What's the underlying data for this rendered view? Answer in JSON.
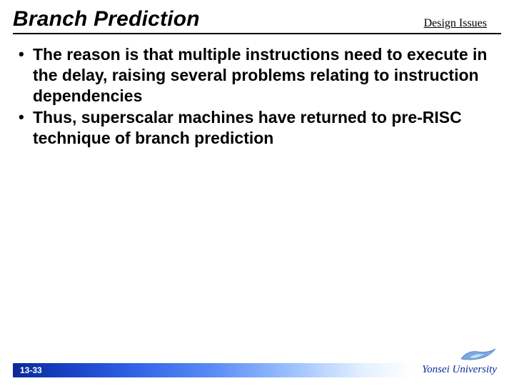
{
  "header": {
    "title": "Branch Prediction",
    "subtitle": "Design Issues"
  },
  "bullets": [
    "The reason is that multiple instructions need to execute in the delay, raising several problems relating to instruction dependencies",
    "Thus, superscalar machines have returned to pre-RISC technique of branch prediction"
  ],
  "footer": {
    "page": "13-33",
    "university": "Yonsei University"
  }
}
